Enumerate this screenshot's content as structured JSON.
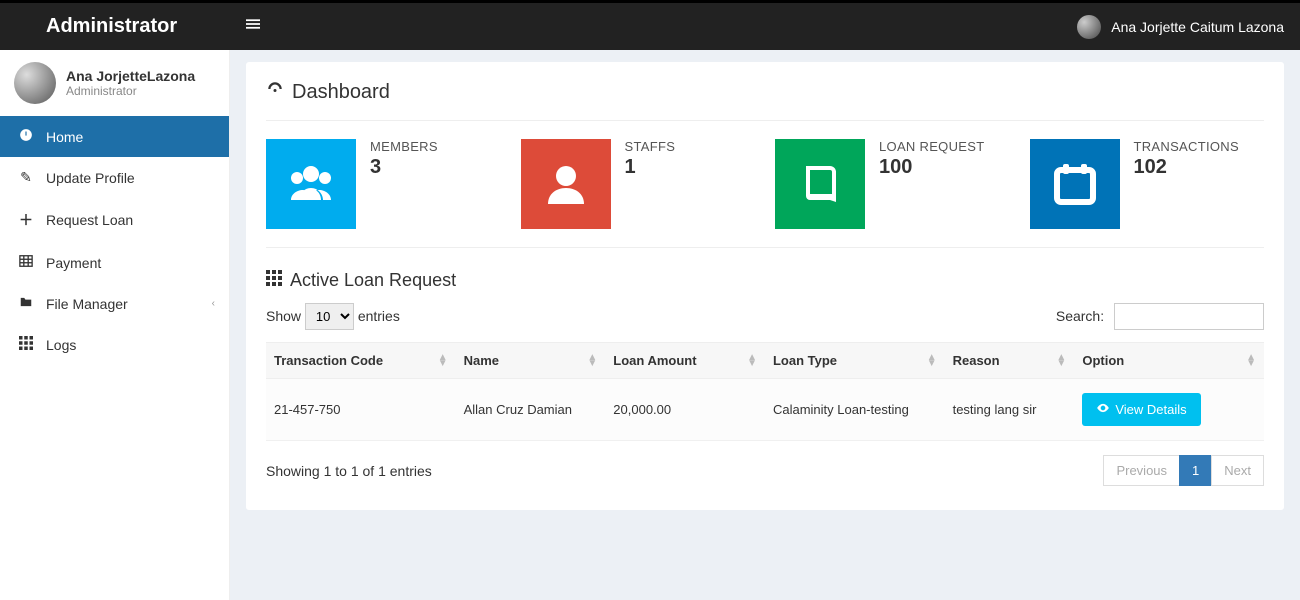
{
  "header": {
    "brand": "Administrator",
    "user_name": "Ana Jorjette Caitum Lazona"
  },
  "sidebar": {
    "user": {
      "name": "Ana JorjetteLazona",
      "role": "Administrator"
    },
    "items": [
      {
        "label": "Home"
      },
      {
        "label": "Update Profile"
      },
      {
        "label": "Request Loan"
      },
      {
        "label": "Payment"
      },
      {
        "label": "File Manager"
      },
      {
        "label": "Logs"
      }
    ]
  },
  "page": {
    "title": "Dashboard",
    "stats": {
      "members": {
        "label": "MEMBERS",
        "value": "3"
      },
      "staffs": {
        "label": "STAFFS",
        "value": "1"
      },
      "loan_request": {
        "label": "LOAN REQUEST",
        "value": "100"
      },
      "transactions": {
        "label": "TRANSACTIONS",
        "value": "102"
      }
    },
    "active_loan": {
      "title": "Active Loan Request",
      "show_label": "Show",
      "entries_label": "entries",
      "show_value": "10",
      "search_label": "Search:",
      "search_value": "",
      "columns": [
        "Transaction Code",
        "Name",
        "Loan Amount",
        "Loan Type",
        "Reason",
        "Option"
      ],
      "row": {
        "code": "21-457-750",
        "name": "Allan Cruz Damian",
        "amount": "20,000.00",
        "type": "Calaminity Loan-testing",
        "reason": "testing lang sir",
        "view_label": "View Details"
      },
      "info": "Showing 1 to 1 of 1 entries",
      "pager": {
        "prev": "Previous",
        "page": "1",
        "next": "Next"
      }
    }
  }
}
